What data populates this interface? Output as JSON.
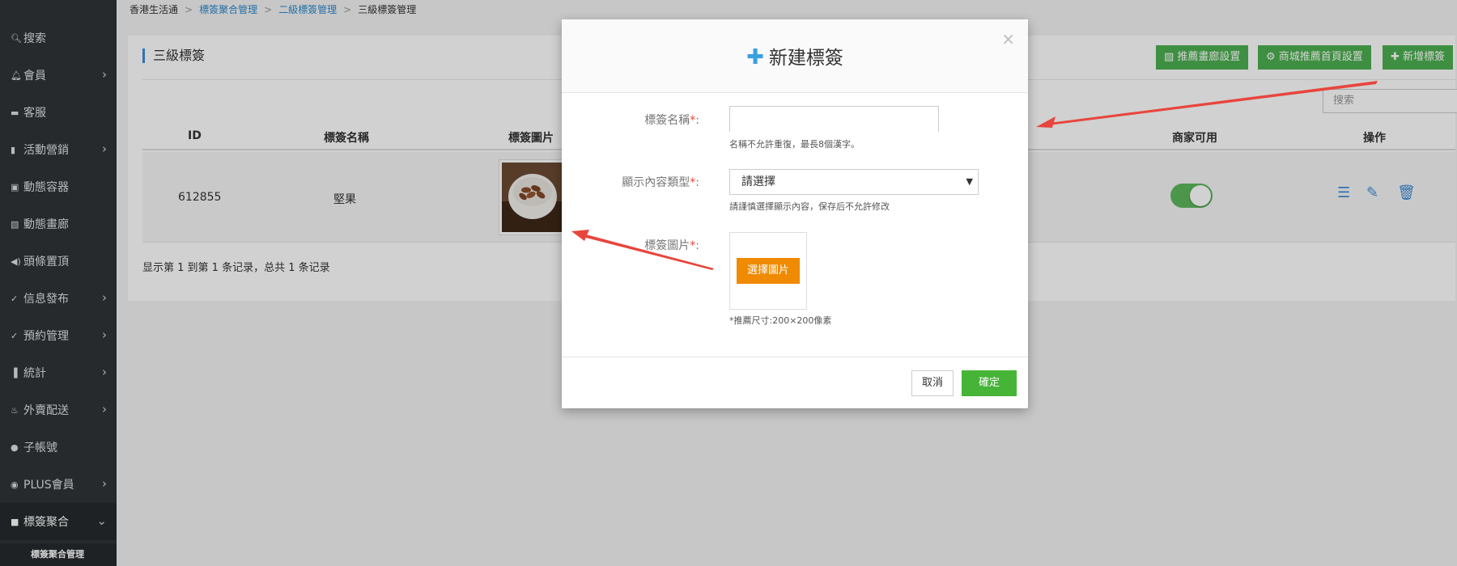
{
  "sidebar": {
    "items": [
      {
        "label": "搜索",
        "icon": "search-icon",
        "glyph": "🔍︎",
        "chev": ""
      },
      {
        "label": "會員",
        "icon": "bell-icon",
        "glyph": "🔔︎",
        "chev": "›"
      },
      {
        "label": "客服",
        "icon": "chat-icon",
        "glyph": "▬",
        "chev": ""
      },
      {
        "label": "活動營銷",
        "icon": "flag-icon",
        "glyph": "▮",
        "chev": "›"
      },
      {
        "label": "動態容器",
        "icon": "box-icon",
        "glyph": "▣",
        "chev": ""
      },
      {
        "label": "動態畫廊",
        "icon": "image-icon",
        "glyph": "▧",
        "chev": ""
      },
      {
        "label": "頭條置頂",
        "icon": "volume-icon",
        "glyph": "◀)",
        "chev": ""
      },
      {
        "label": "信息發布",
        "icon": "check-icon",
        "glyph": "✓",
        "chev": "›"
      },
      {
        "label": "預約管理",
        "icon": "check-icon",
        "glyph": "✓",
        "chev": "›"
      },
      {
        "label": "統計",
        "icon": "bar-chart-icon",
        "glyph": "▐",
        "chev": "›"
      },
      {
        "label": "外賣配送",
        "icon": "cutlery-icon",
        "glyph": "♨",
        "chev": "›"
      },
      {
        "label": "子帳號",
        "icon": "user-icon",
        "glyph": "●",
        "chev": ""
      },
      {
        "label": "PLUS會員",
        "icon": "wifi-icon",
        "glyph": "◉",
        "chev": "›"
      },
      {
        "label": "標簽聚合",
        "icon": "square-icon",
        "glyph": "■",
        "chev": "⌄"
      }
    ],
    "sub_item": "標簽聚合管理"
  },
  "breadcrumb": {
    "home": "香港生活通",
    "level1": "標簽聚合管理",
    "level2": "二級標簽管理",
    "current": "三級標簽管理",
    "sep": ">"
  },
  "panel": {
    "title": "三級標簽",
    "btn_gallery": "推薦畫廊設置",
    "btn_home": "商城推薦首頁設置",
    "btn_new": "新增標簽",
    "search_placeholder": "搜索"
  },
  "table": {
    "headers": {
      "id": "ID",
      "name": "標簽名稱",
      "image": "標簽圖片",
      "merchant": "商家可用",
      "action": "操作"
    },
    "rows": [
      {
        "id": "612855",
        "name": "堅果",
        "merchant_enabled": true
      }
    ],
    "footer": "显示第 1 到第 1 条记录，总共 1 条记录"
  },
  "modal": {
    "title": "新建標簽",
    "close": "×",
    "name_label": "標簽名稱",
    "name_help": "名稱不允許重復，最長8個漢字。",
    "type_label": "顯示內容類型",
    "type_value": "請選擇",
    "type_help": "請謹慎選擇顯示內容，保存后不允許修改",
    "image_label": "標簽圖片",
    "pick_image": "選擇圖片",
    "image_help": "*推薦尺寸:200×200像素",
    "required_mark": "*",
    "colon": ":",
    "cancel": "取消",
    "confirm": "確定"
  },
  "colors": {
    "sidebar_bg": "#2f3437",
    "green": "#4caf50",
    "orange": "#f08a00",
    "arrow": "#e8453c",
    "accent": "#3c8dd6"
  }
}
